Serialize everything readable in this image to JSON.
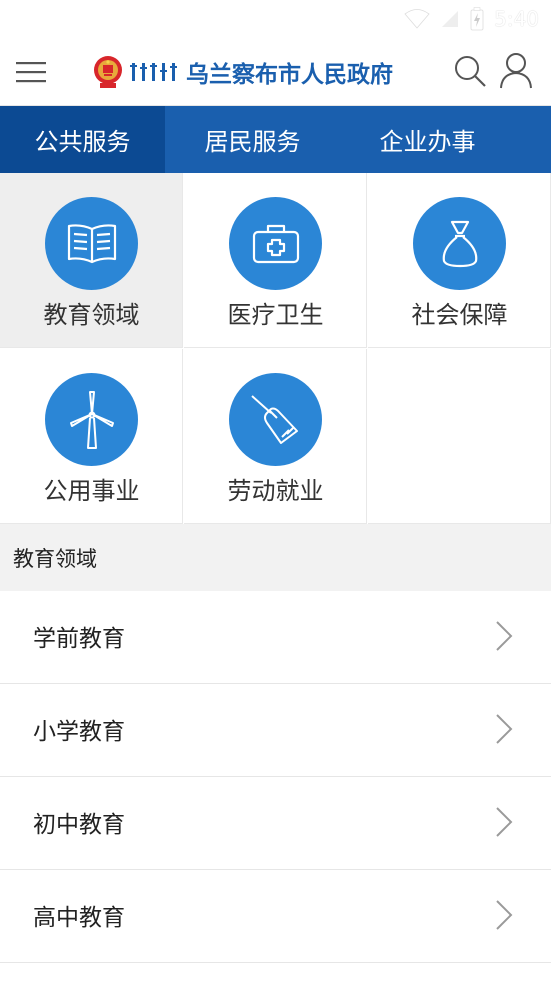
{
  "status": {
    "time": "5:40"
  },
  "header": {
    "title": "乌兰察布市人民政府"
  },
  "tabs": [
    {
      "label": "公共服务",
      "active": true
    },
    {
      "label": "居民服务",
      "active": false
    },
    {
      "label": "企业办事",
      "active": false
    }
  ],
  "categories": [
    {
      "label": "教育领域",
      "icon": "book-icon"
    },
    {
      "label": "医疗卫生",
      "icon": "medical-kit-icon"
    },
    {
      "label": "社会保障",
      "icon": "money-bag-icon"
    },
    {
      "label": "公用事业",
      "icon": "wind-turbine-icon"
    },
    {
      "label": "劳动就业",
      "icon": "broom-icon"
    }
  ],
  "section": {
    "title": "教育领域"
  },
  "list": [
    {
      "label": "学前教育"
    },
    {
      "label": "小学教育"
    },
    {
      "label": "初中教育"
    },
    {
      "label": "高中教育"
    }
  ],
  "colors": {
    "brand": "#1a5fae",
    "tab_active": "#0c4a93",
    "icon_circle": "#2b86d6"
  }
}
